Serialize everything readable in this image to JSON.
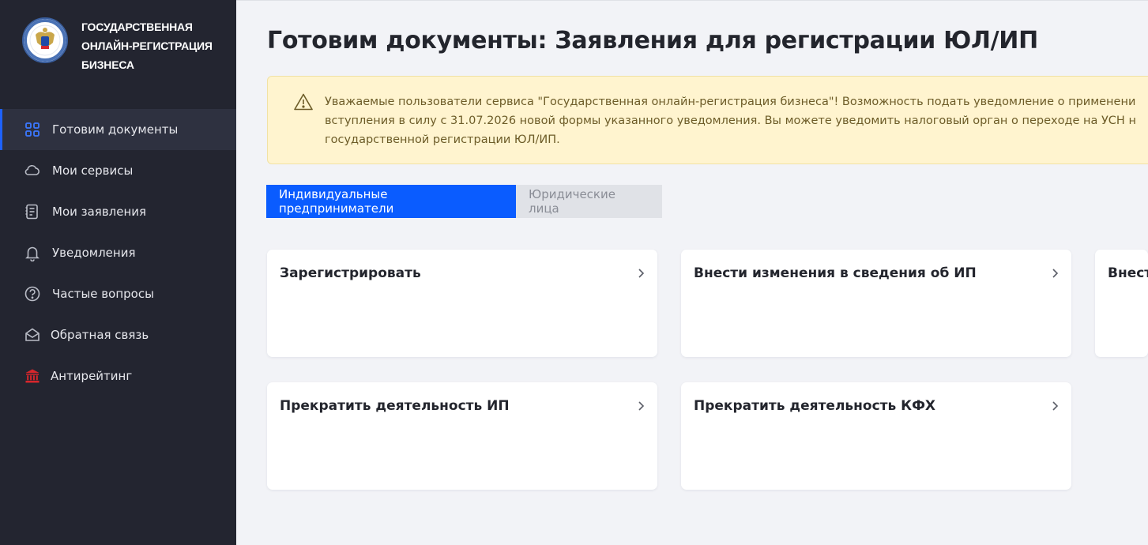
{
  "brand": {
    "lines": [
      "ГОСУДАРСТВЕННАЯ",
      "ОНЛАЙН-РЕГИСТРАЦИЯ",
      "БИЗНЕСА"
    ]
  },
  "sidebar": {
    "items": [
      {
        "label": "Готовим документы",
        "icon": "grid-icon",
        "active": true
      },
      {
        "label": "Мои сервисы",
        "icon": "cloud-icon"
      },
      {
        "label": "Мои заявления",
        "icon": "document-list-icon"
      },
      {
        "label": "Уведомления",
        "icon": "bell-icon"
      },
      {
        "label": "Частые вопросы",
        "icon": "question-circle-icon"
      },
      {
        "label": "Обратная связь",
        "icon": "envelope-icon"
      },
      {
        "label": "Антирейтинг",
        "icon": "institution-icon"
      }
    ]
  },
  "main": {
    "title": "Готовим документы: Заявления для регистрации ЮЛ/ИП",
    "notice": {
      "icon": "warning-icon",
      "lines": [
        "Уважаемые пользователи сервиса \"Государственная онлайн-регистрация бизнеса\"! Возможность подать уведомление о применени",
        "вступления в силу с 31.07.2026 новой формы указанного уведомления. Вы можете уведомить налоговый орган о переходе на УСН н",
        "государственной регистрации ЮЛ/ИП."
      ]
    },
    "tabs": [
      {
        "label": "Индивидуальные предприниматели",
        "active": true
      },
      {
        "label": "Юридические лица",
        "active": false
      }
    ],
    "cards": [
      {
        "title": "Зарегистрировать"
      },
      {
        "title": "Внести изменения в сведения об ИП"
      },
      {
        "title": "Внест"
      },
      {
        "title": "Прекратить деятельность ИП"
      },
      {
        "title": "Прекратить деятельность КФХ"
      }
    ]
  },
  "colors": {
    "sidebar_bg": "#232530",
    "accent": "#0a5cff",
    "notice_bg": "#fff4cf",
    "antirating_icon": "#d8262c"
  }
}
